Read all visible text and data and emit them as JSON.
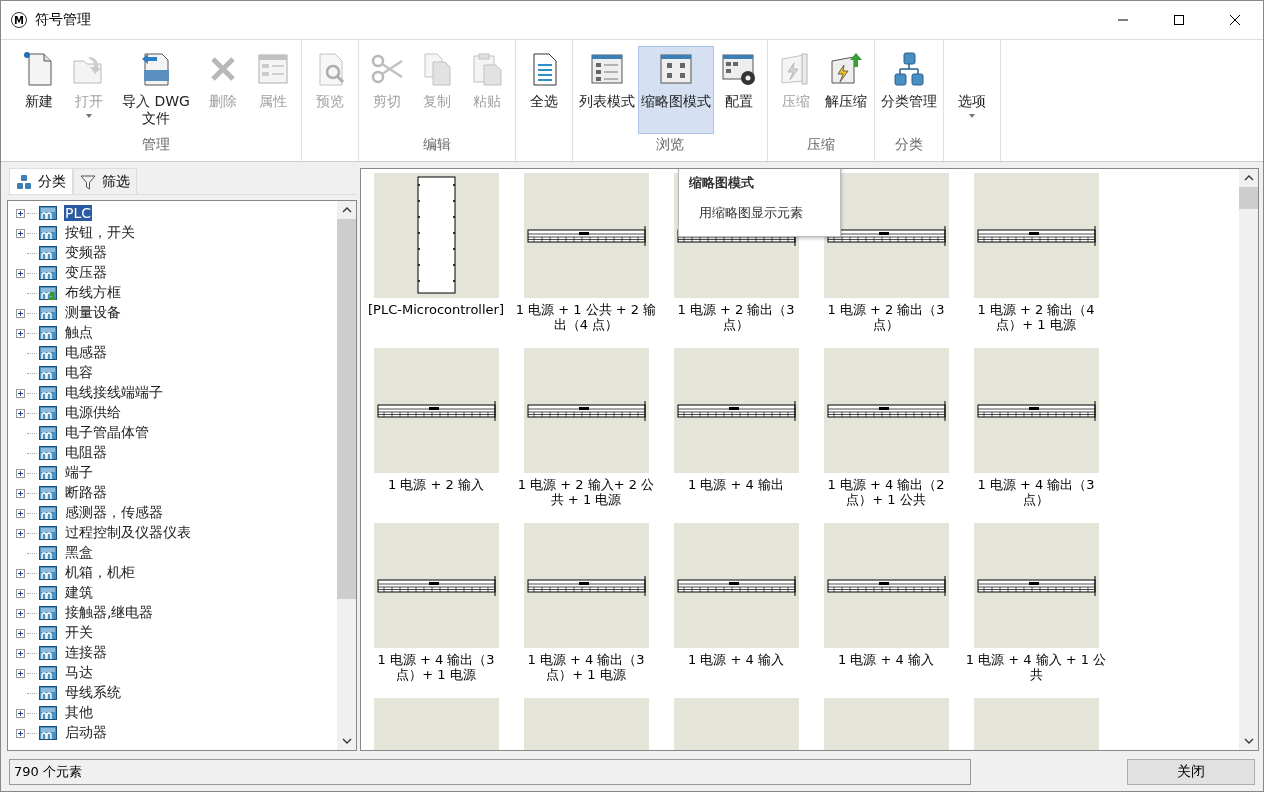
{
  "window": {
    "title": "符号管理",
    "icon_letter": "M"
  },
  "ribbon": [
    {
      "label": "管理",
      "buttons": [
        {
          "label": "新建",
          "disabled": false,
          "selected": false,
          "dropdown": false
        },
        {
          "label": "打开",
          "disabled": true,
          "selected": false,
          "dropdown": true
        },
        {
          "label": "导入 DWG 文件",
          "disabled": false,
          "selected": false,
          "dropdown": false
        },
        {
          "label": "删除",
          "disabled": true,
          "selected": false,
          "dropdown": false
        },
        {
          "label": "属性",
          "disabled": true,
          "selected": false,
          "dropdown": false
        }
      ]
    },
    {
      "buttons": [
        {
          "label": "预览",
          "disabled": true,
          "selected": false,
          "dropdown": false
        }
      ]
    },
    {
      "label": "编辑",
      "buttons": [
        {
          "label": "剪切",
          "disabled": true,
          "selected": false,
          "dropdown": false
        },
        {
          "label": "复制",
          "disabled": true,
          "selected": false,
          "dropdown": false
        },
        {
          "label": "粘贴",
          "disabled": true,
          "selected": false,
          "dropdown": false
        }
      ]
    },
    {
      "buttons": [
        {
          "label": "全选",
          "disabled": false,
          "selected": false,
          "dropdown": false
        }
      ]
    },
    {
      "label": "浏览",
      "buttons": [
        {
          "label": "列表模式",
          "disabled": false,
          "selected": false,
          "dropdown": false
        },
        {
          "label": "缩略图模式",
          "disabled": false,
          "selected": true,
          "dropdown": false
        },
        {
          "label": "配置",
          "disabled": false,
          "selected": false,
          "dropdown": false
        }
      ]
    },
    {
      "label": "压缩",
      "buttons": [
        {
          "label": "压缩",
          "disabled": true,
          "selected": false,
          "dropdown": false
        },
        {
          "label": "解压缩",
          "disabled": false,
          "selected": false,
          "dropdown": false
        }
      ]
    },
    {
      "label": "分类",
      "buttons": [
        {
          "label": "分类管理",
          "disabled": false,
          "selected": false,
          "dropdown": false
        }
      ]
    },
    {
      "buttons": [
        {
          "label": "选项",
          "disabled": false,
          "selected": false,
          "dropdown": true
        }
      ]
    }
  ],
  "panel_tabs": [
    {
      "label": "分类",
      "selected": true
    },
    {
      "label": "筛选",
      "selected": false
    }
  ],
  "tree": [
    {
      "label": "PLC",
      "expandable": true,
      "selected": true,
      "kind": "folder"
    },
    {
      "label": "按钮，开关",
      "expandable": true,
      "selected": false,
      "kind": "folder"
    },
    {
      "label": "变频器",
      "expandable": false,
      "selected": false,
      "kind": "folder"
    },
    {
      "label": "变压器",
      "expandable": true,
      "selected": false,
      "kind": "folder"
    },
    {
      "label": "布线方框",
      "expandable": false,
      "selected": false,
      "kind": "user"
    },
    {
      "label": "测量设备",
      "expandable": true,
      "selected": false,
      "kind": "folder"
    },
    {
      "label": "触点",
      "expandable": true,
      "selected": false,
      "kind": "folder"
    },
    {
      "label": "电感器",
      "expandable": false,
      "selected": false,
      "kind": "folder"
    },
    {
      "label": "电容",
      "expandable": false,
      "selected": false,
      "kind": "folder"
    },
    {
      "label": "电线接线端端子",
      "expandable": true,
      "selected": false,
      "kind": "folder"
    },
    {
      "label": "电源供给",
      "expandable": true,
      "selected": false,
      "kind": "folder"
    },
    {
      "label": "电子管晶体管",
      "expandable": false,
      "selected": false,
      "kind": "folder"
    },
    {
      "label": "电阻器",
      "expandable": false,
      "selected": false,
      "kind": "folder"
    },
    {
      "label": "端子",
      "expandable": true,
      "selected": false,
      "kind": "folder"
    },
    {
      "label": "断路器",
      "expandable": true,
      "selected": false,
      "kind": "folder"
    },
    {
      "label": "感测器，传感器",
      "expandable": true,
      "selected": false,
      "kind": "folder"
    },
    {
      "label": "过程控制及仪器仪表",
      "expandable": true,
      "selected": false,
      "kind": "folder"
    },
    {
      "label": "黑盒",
      "expandable": false,
      "selected": false,
      "kind": "folder"
    },
    {
      "label": "机箱，机柜",
      "expandable": true,
      "selected": false,
      "kind": "folder"
    },
    {
      "label": "建筑",
      "expandable": true,
      "selected": false,
      "kind": "folder"
    },
    {
      "label": "接触器,继电器",
      "expandable": true,
      "selected": false,
      "kind": "folder"
    },
    {
      "label": "开关",
      "expandable": true,
      "selected": false,
      "kind": "folder"
    },
    {
      "label": "连接器",
      "expandable": true,
      "selected": false,
      "kind": "folder"
    },
    {
      "label": "马达",
      "expandable": true,
      "selected": false,
      "kind": "folder"
    },
    {
      "label": "母线系统",
      "expandable": false,
      "selected": false,
      "kind": "folder"
    },
    {
      "label": "其他",
      "expandable": true,
      "selected": false,
      "kind": "folder"
    },
    {
      "label": "启动器",
      "expandable": true,
      "selected": false,
      "kind": "folder"
    }
  ],
  "thumbnails": [
    {
      "label": "[PLC-Microcontroller]",
      "kind": "plc"
    },
    {
      "label": "1 电源 + 1 公共 + 2 输出（4 点）",
      "kind": "rail"
    },
    {
      "label": "1 电源 + 2 输出（3 点）",
      "kind": "rail"
    },
    {
      "label": "1 电源 + 2 输出（3 点）",
      "kind": "rail"
    },
    {
      "label": "1 电源 + 2 输出（4 点）+ 1 电源",
      "kind": "rail"
    },
    {
      "label": "1 电源 + 2 输入",
      "kind": "rail"
    },
    {
      "label": "1 电源 + 2 输入+ 2 公共 + 1 电源",
      "kind": "rail"
    },
    {
      "label": "1 电源 + 4 输出",
      "kind": "rail"
    },
    {
      "label": "1 电源 + 4 输出（2 点）+ 1 公共",
      "kind": "rail"
    },
    {
      "label": "1 电源 + 4 输出（3 点）",
      "kind": "rail"
    },
    {
      "label": "1 电源 + 4 输出（3 点）+ 1 电源",
      "kind": "rail"
    },
    {
      "label": "1 电源 + 4 输出（3 点）+ 1 电源",
      "kind": "rail"
    },
    {
      "label": "1 电源 + 4 输入",
      "kind": "rail"
    },
    {
      "label": "1 电源 + 4 输入",
      "kind": "rail"
    },
    {
      "label": "1 电源 + 4 输入 + 1 公共",
      "kind": "rail"
    },
    {
      "kind": "blank"
    },
    {
      "kind": "blank"
    },
    {
      "kind": "blank"
    },
    {
      "kind": "blank"
    },
    {
      "kind": "blank"
    }
  ],
  "tooltip": {
    "title": "缩略图模式",
    "text": "用缩略图显示元素"
  },
  "status_bar": {
    "count": "790 个元素",
    "close_button": "关闭"
  }
}
